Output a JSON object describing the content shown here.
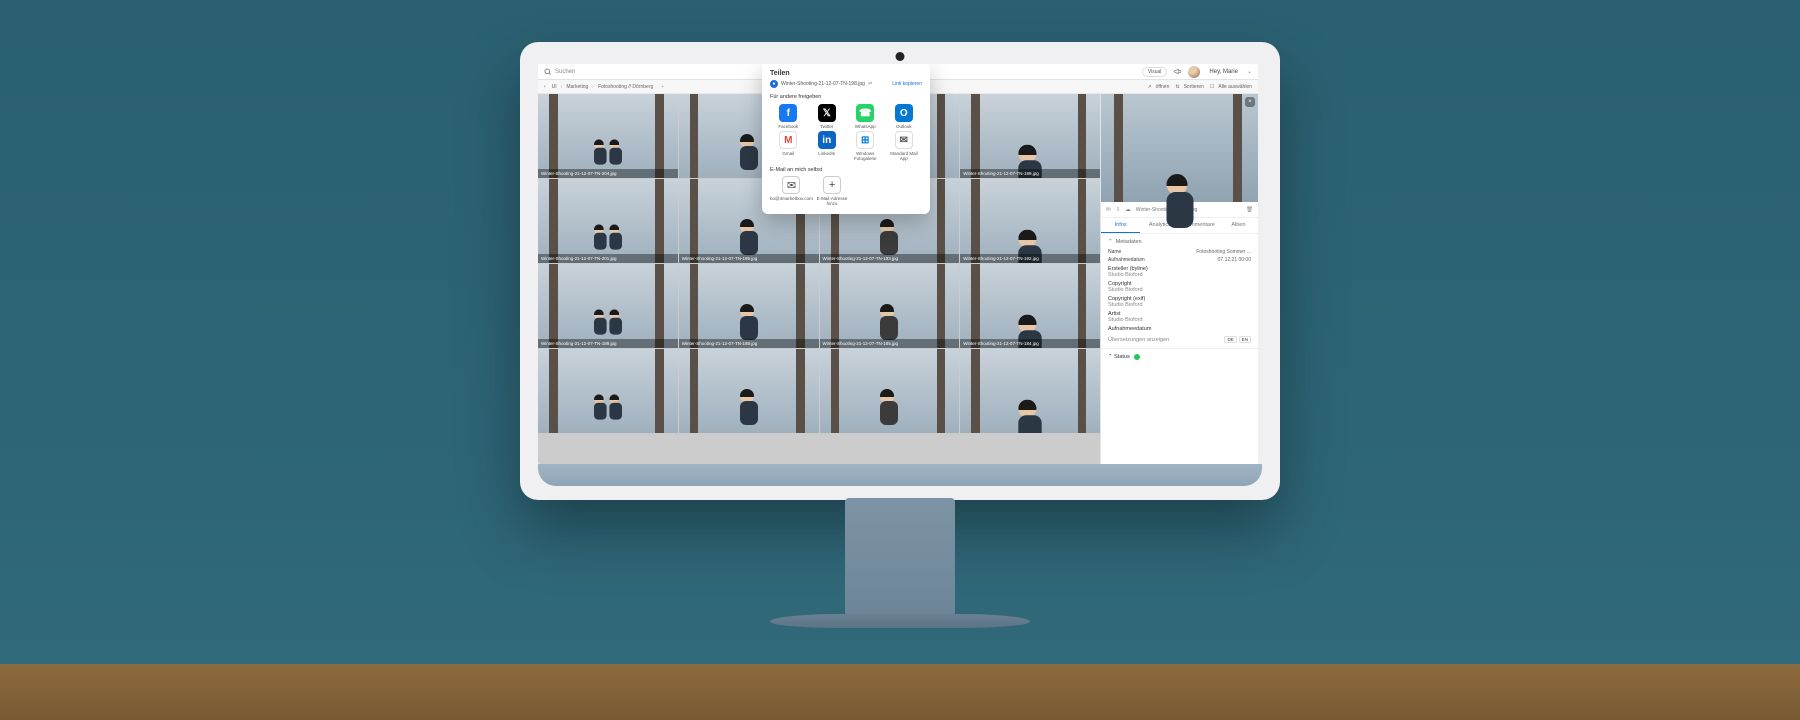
{
  "topbar": {
    "search_placeholder": "Suchen",
    "visual_search": "Visual",
    "greeting": "Hey, Marie"
  },
  "breadcrumb": [
    "UI",
    "Marketing",
    "Fotoshooting // Dörnberg"
  ],
  "toolbar": {
    "open": "öffnen",
    "sort": "Sortieren",
    "select_all": "Alle auswählen"
  },
  "dialog": {
    "title": "Teilen",
    "filename": "Winter-Shooting-21-12-07-TN-198.jpg",
    "copy_link": "Link kopieren",
    "share_with": "Für andere freigeben",
    "share_items": [
      {
        "name": "Facebook",
        "cls": "fb",
        "glyph": "f"
      },
      {
        "name": "Twitter",
        "cls": "tw",
        "glyph": "𝕏"
      },
      {
        "name": "WhatsApp",
        "cls": "wa",
        "glyph": "☎"
      },
      {
        "name": "Outlook",
        "cls": "ol",
        "glyph": "O"
      },
      {
        "name": "Gmail",
        "cls": "gm",
        "glyph": "M"
      },
      {
        "name": "LinkedIn",
        "cls": "li",
        "glyph": "in"
      },
      {
        "name": "Windows Fotogalerie",
        "cls": "wf",
        "glyph": "⊞"
      },
      {
        "name": "Standard Mail App",
        "cls": "sm",
        "glyph": "✉"
      }
    ],
    "mail_self": "E-Mail an mich selbst",
    "mail_items": [
      {
        "name": "bo@4marketbox.com",
        "glyph": "✉"
      },
      {
        "name": "E-Mail-Adresse hinzu",
        "glyph": "+"
      }
    ]
  },
  "thumbs": [
    "Winter-Shooting-21-12-07-TN-204.jpg",
    "",
    "",
    "Winter-Shooting-21-12-07-TN-199.jpg",
    "Winter-Shooting-21-12-07-TN-201.jpg",
    "Winter-Shooting-21-12-07-TN-195.jpg",
    "Winter-Shooting-21-12-07-TN-193.jpg",
    "Winter-Shooting-21-12-07-TN-192.jpg",
    "Winter-Shooting-21-12-07-TN-189.jpg",
    "Winter-Shooting-21-12-07-TN-188.jpg",
    "Winter-Shooting-21-12-07-TN-185.jpg",
    "Winter-Shooting-21-12-07-TN-184.jpg",
    "",
    "",
    "",
    ""
  ],
  "sidebar": {
    "filename": "Winter-Shooting-21-1(..).jpg",
    "tabs": [
      "Infos",
      "Analytics",
      "Kommentare",
      "Alben"
    ],
    "sect_meta": "Metadaten",
    "meta": [
      {
        "k": "Name",
        "v": "Fotoshooting Sommer ..."
      },
      {
        "k": "Aufnahmedatum",
        "v": "07.12.21 00:00"
      }
    ],
    "blocks": [
      {
        "k": "Ersteller (byline)",
        "v": "Studio Bioford"
      },
      {
        "k": "Copyright",
        "v": "Studio Bioford"
      },
      {
        "k": "Copyright (exif)",
        "v": "Studio Bioford"
      },
      {
        "k": "Artist",
        "v": "Studio Bioford"
      },
      {
        "k": "Aufnahmeedatum",
        "v": ""
      }
    ],
    "translations": "Übersetzungen anzeigen",
    "langs": [
      "DE",
      "EN"
    ],
    "sect_status": "Status"
  }
}
